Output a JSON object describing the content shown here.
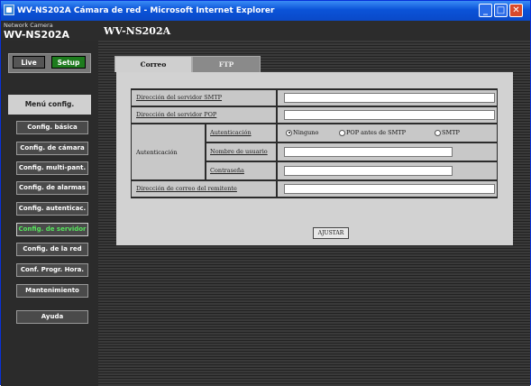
{
  "window": {
    "title": "WV-NS202A Cámara de red - Microsoft Internet Explorer"
  },
  "header": {
    "brand_small": "Network Camera",
    "brand_big": "WV-NS202A",
    "model": "WV-NS202A"
  },
  "mode": {
    "live": "Live",
    "setup": "Setup"
  },
  "menu": {
    "title": "Menú config.",
    "items": [
      {
        "label": "Config. básica"
      },
      {
        "label": "Config. de cámara"
      },
      {
        "label": "Config. multi-pant."
      },
      {
        "label": "Config. de alarmas"
      },
      {
        "label": "Config. autenticac."
      },
      {
        "label": "Config. de servidor"
      },
      {
        "label": "Config. de la red"
      },
      {
        "label": "Conf. Progr. Hora."
      },
      {
        "label": "Mantenimiento"
      },
      {
        "label": "Ayuda"
      }
    ],
    "active_index": 5
  },
  "tabs": [
    {
      "label": "Correo"
    },
    {
      "label": "FTP"
    }
  ],
  "form": {
    "smtp_label": "Dirección del servidor SMTP",
    "smtp_value": "",
    "pop_label": "Dirección del servidor POP",
    "pop_value": "",
    "auth_group_label": "Autenticación",
    "auth_label": "Autenticación",
    "auth_options": [
      {
        "label": "Ninguno",
        "selected": true
      },
      {
        "label": "POP antes de SMTP",
        "selected": false
      },
      {
        "label": "SMTP",
        "selected": false
      }
    ],
    "username_label": "Nombre de usuario",
    "username_value": "",
    "password_label": "Contraseña",
    "password_value": "",
    "sender_label": "Dirección de correo del remitente",
    "sender_value": "",
    "submit_label": "AJUSTAR"
  },
  "colors": {
    "active_menu_text": "#56e45c",
    "setup_green": "#1e7c1e",
    "titlebar_blue": "#0b53d8"
  }
}
